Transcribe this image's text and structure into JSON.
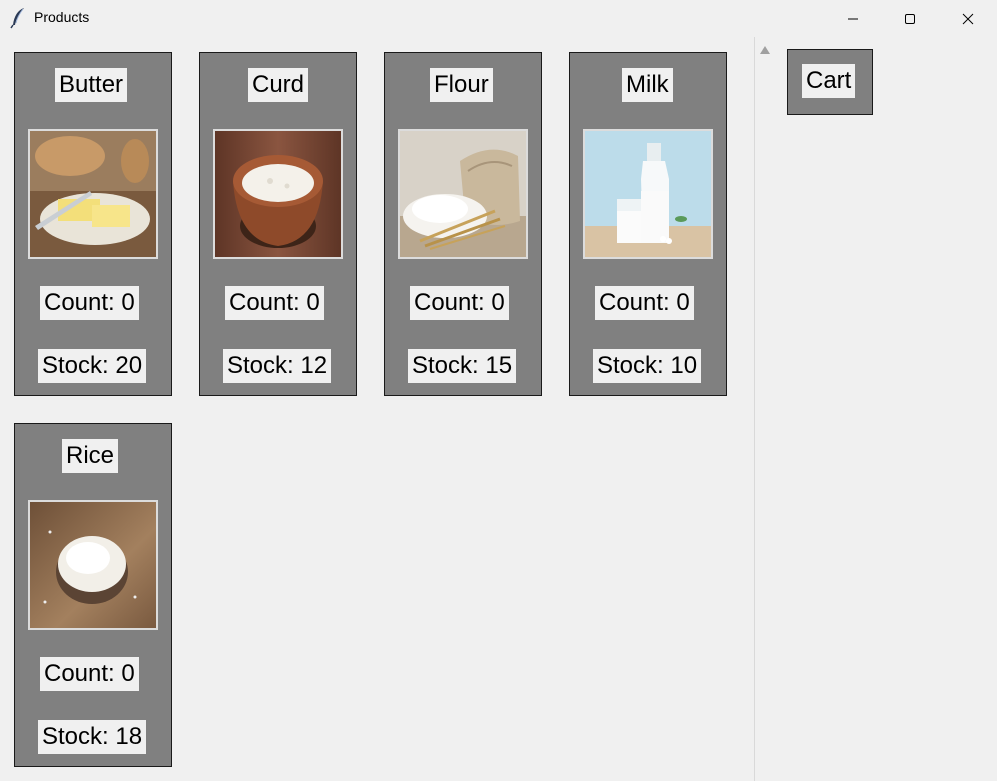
{
  "window": {
    "title": "Products",
    "icon": "feather-icon",
    "controls": [
      "minimize-icon",
      "maximize-icon",
      "close-icon"
    ]
  },
  "products": [
    {
      "name": "Butter",
      "count": "Count: 0",
      "stock": "Stock: 20",
      "image": "butter-photo"
    },
    {
      "name": "Curd",
      "count": "Count: 0",
      "stock": "Stock: 12",
      "image": "curd-photo"
    },
    {
      "name": "Flour",
      "count": "Count: 0",
      "stock": "Stock: 15",
      "image": "flour-photo"
    },
    {
      "name": "Milk",
      "count": "Count: 0",
      "stock": "Stock: 10",
      "image": "milk-photo"
    },
    {
      "name": "Rice",
      "count": "Count: 0",
      "stock": "Stock: 18",
      "image": "rice-photo"
    }
  ],
  "cart": {
    "label": "Cart"
  },
  "colors": {
    "card_bg": "#808080",
    "label_bg": "#f0f0f0",
    "window_bg": "#f0f0f0"
  }
}
